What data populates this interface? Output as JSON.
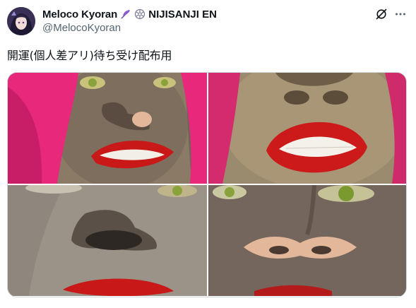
{
  "author": {
    "display_name": "Meloco Kyoran",
    "org": "NIJISANJI EN",
    "handle": "@MelocoKyoran",
    "icons": [
      "avatar",
      "purple-feather-emoji",
      "snowflake-gear-emoji"
    ]
  },
  "actions": {
    "icons": [
      "grok-icon",
      "more-icon"
    ]
  },
  "tweet": {
    "text": "開運(個人差アリ)待ち受け配布用"
  },
  "media": {
    "images": [
      {
        "subject": "face-closeup-nose-lips-pink-hair"
      },
      {
        "subject": "face-closeup-smile-red-lips"
      },
      {
        "subject": "face-closeup-dark-nose"
      },
      {
        "subject": "face-closeup-pale-nose-green-eyes"
      }
    ]
  },
  "colors": {
    "text_primary": "#0f1419",
    "text_secondary": "#536471",
    "border": "#cfd9de",
    "hair_pink": "#e8287a",
    "lip_red": "#c81818",
    "eye_green": "#8aa23a"
  }
}
